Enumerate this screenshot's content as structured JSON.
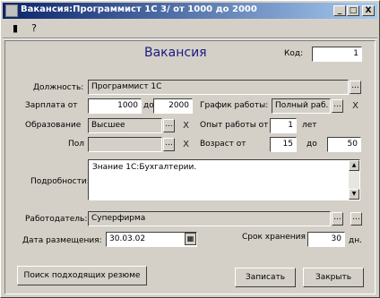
{
  "window": {
    "title": "Вакансия:Программист 1С 3/ от 1000 до 2000",
    "btn_minimize": "_",
    "btn_maximize": "□",
    "btn_close": "X"
  },
  "toolbar": {
    "icon1": "▮",
    "icon2": "?"
  },
  "form": {
    "heading": "Вакансия",
    "code_label": "Код:",
    "code_value": "1",
    "position_label": "Должность:",
    "position_value": "Программист 1С",
    "salary_label": "Зарплата от",
    "salary_from": "1000",
    "salary_to_label": "до",
    "salary_to": "2000",
    "schedule_label": "График работы:",
    "schedule_value": "Полный раб. д",
    "education_label": "Образование",
    "education_value": "Высшее",
    "experience_label": "Опыт работы от",
    "experience_value": "1",
    "experience_unit": "лет",
    "gender_label": "Пол",
    "gender_value": "",
    "age_label": "Возраст от",
    "age_from": "15",
    "age_to_label": "до",
    "age_to": "50",
    "details_label": "Подробности:",
    "details_value": "Знание 1С:Бухгалтерии.",
    "employer_label": "Работодатель:",
    "employer_value": "Суперфирма",
    "date_label": "Дата размещения:",
    "date_value": "30.03.02",
    "retention_label": "Срок хранения",
    "retention_value": "30",
    "retention_unit": "дн."
  },
  "buttons": {
    "select": "...",
    "clear": "X",
    "find_resumes": "Поиск подходящих резюме",
    "save": "Записать",
    "close": "Закрыть"
  }
}
